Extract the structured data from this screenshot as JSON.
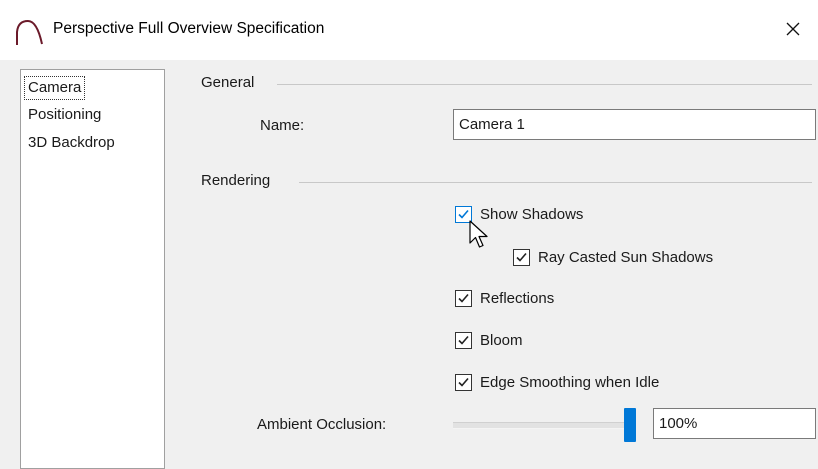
{
  "window": {
    "title": "Perspective Full Overview Specification",
    "icon": "camera-arc-icon",
    "close_icon": "close-icon"
  },
  "nav": {
    "items": [
      {
        "label": "Camera",
        "selected": true
      },
      {
        "label": "Positioning",
        "selected": false
      },
      {
        "label": "3D Backdrop",
        "selected": false
      }
    ]
  },
  "general": {
    "heading": "General",
    "name_label": "Name:",
    "name_value": "Camera 1"
  },
  "rendering": {
    "heading": "Rendering",
    "options": [
      {
        "label": "Show Shadows",
        "checked": true
      },
      {
        "label": "Ray Casted Sun Shadows",
        "checked": true
      },
      {
        "label": "Reflections",
        "checked": true
      },
      {
        "label": "Bloom",
        "checked": true
      },
      {
        "label": "Edge Smoothing when Idle",
        "checked": true
      }
    ],
    "ambient_occlusion_label": "Ambient Occlusion:",
    "ambient_occlusion_value": "100%",
    "ambient_occlusion_level": 1.0
  },
  "colors": {
    "accent": "#0078d7",
    "window_bg": "#f0f0f0",
    "titlebar_bg": "#ffffff"
  }
}
